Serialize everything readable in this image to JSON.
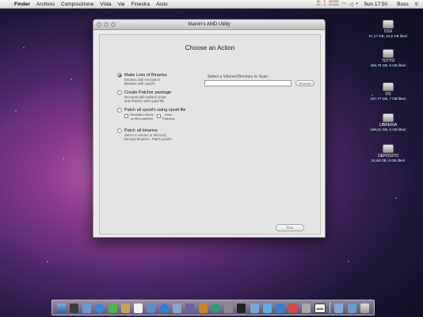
{
  "menubar": {
    "apple_icon": "",
    "items": [
      "Finder",
      "Archivio",
      "Composizione",
      "Vista",
      "Vai",
      "Finestra",
      "Aiuto"
    ],
    "meters": {
      "line1": "DU. 0. 3023KB",
      "line2": "DU. 0. 3221KB"
    },
    "clock": "Sun 17:50",
    "user": "Boss"
  },
  "desktop": {
    "drives": [
      {
        "name": "OSX",
        "info": "57,17 GB, 22,8 GB liberi"
      },
      {
        "name": "TUTTO",
        "info": "465,76 GB, 6 GB liberi"
      },
      {
        "name": "OS",
        "info": "157,77 GB, 7 GB liberi"
      },
      {
        "name": "LIBRERIA",
        "info": "189,51 GB, 6 GB liberi"
      },
      {
        "name": "DEPOSITO",
        "info": "24,68 GB, 6 GB liberi"
      }
    ]
  },
  "window": {
    "title": "Marvin's AMD Utility",
    "heading": "Choose an Action",
    "options": [
      {
        "label": "Make Lists of Binaries",
        "desc": [
          "Binaries with excryption",
          "Binaries with cpuid's"
        ],
        "selected": true
      },
      {
        "label": "Create Patcher package",
        "desc": [
          "Decrypts with replace script",
          "and Patcher with cpuid fils"
        ],
        "selected": false
      },
      {
        "label": "Patch all cpuid's using cpuid file",
        "desc": [],
        "selected": false
      },
      {
        "label": "Patch all binaries",
        "desc": [
          "Select a volume or directory",
          "Decrypt binaries - Patch cpuid's"
        ],
        "selected": false
      }
    ],
    "checks": {
      "simulation": {
        "label1": "Simulation Mode",
        "label2": "no files patched"
      },
      "undo": {
        "label1": "Undo",
        "label2": "Patching"
      }
    },
    "volume_label": "Select a Volume/Directory to Scan",
    "volume_value": "",
    "browse_label": "Browse",
    "run_label": "Run"
  },
  "dock": {
    "icons": [
      "finder-icon",
      "dashboard-icon",
      "mail-icon",
      "safari-icon",
      "ichat-icon",
      "address-book-icon",
      "ical-icon",
      "preview-icon",
      "itunes-icon",
      "photo-icon",
      "imovie-icon",
      "garageband-icon",
      "time-machine-icon",
      "system-preferences-icon",
      "terminal-icon",
      "disk-utility-icon",
      "activity-monitor-icon",
      "xcode-icon",
      "app-icon",
      "script-icon",
      "amd-utility-icon",
      "folder-icon",
      "downloads-icon",
      "trash-icon"
    ],
    "amd_label": "AMD"
  }
}
